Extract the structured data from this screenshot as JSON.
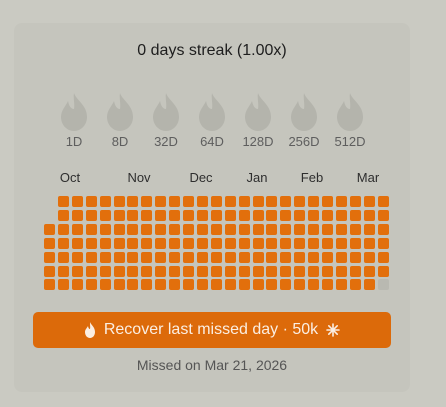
{
  "streak": {
    "title": "0 days streak (1.00x)"
  },
  "milestones": [
    {
      "label": "1D",
      "icon": "flame-icon",
      "reached": false
    },
    {
      "label": "8D",
      "icon": "flame-icon",
      "reached": false
    },
    {
      "label": "32D",
      "icon": "flame-icon",
      "reached": false
    },
    {
      "label": "64D",
      "icon": "flame-icon",
      "reached": false
    },
    {
      "label": "128D",
      "icon": "flame-icon",
      "reached": false
    },
    {
      "label": "256D",
      "icon": "flame-icon",
      "reached": false
    },
    {
      "label": "512D",
      "icon": "flame-icon",
      "reached": false
    }
  ],
  "calendar": {
    "months": [
      "Oct",
      "Nov",
      "Dec",
      "Jan",
      "Feb",
      "Mar"
    ],
    "weeks": 25,
    "days_per_week": 7,
    "first_week_active_days": [
      2,
      3,
      4,
      5,
      6
    ],
    "last_week_active_days": [
      0,
      1,
      2,
      3,
      4,
      5
    ],
    "last_week_missed_days": [
      6
    ],
    "colors": {
      "active": "#e26f0c",
      "missed": "#b9b9b1"
    }
  },
  "recover": {
    "label": "Recover last missed day · 50k",
    "icon": "flame-icon",
    "currency_icon": "sparkle-icon"
  },
  "missed": {
    "text": "Missed on Mar 21, 2026"
  },
  "colors": {
    "accent": "#dc6a0a",
    "card_bg": "#c5c5bd",
    "page_bg": "#cacac2",
    "flame_inactive": "#b4b4ac"
  }
}
